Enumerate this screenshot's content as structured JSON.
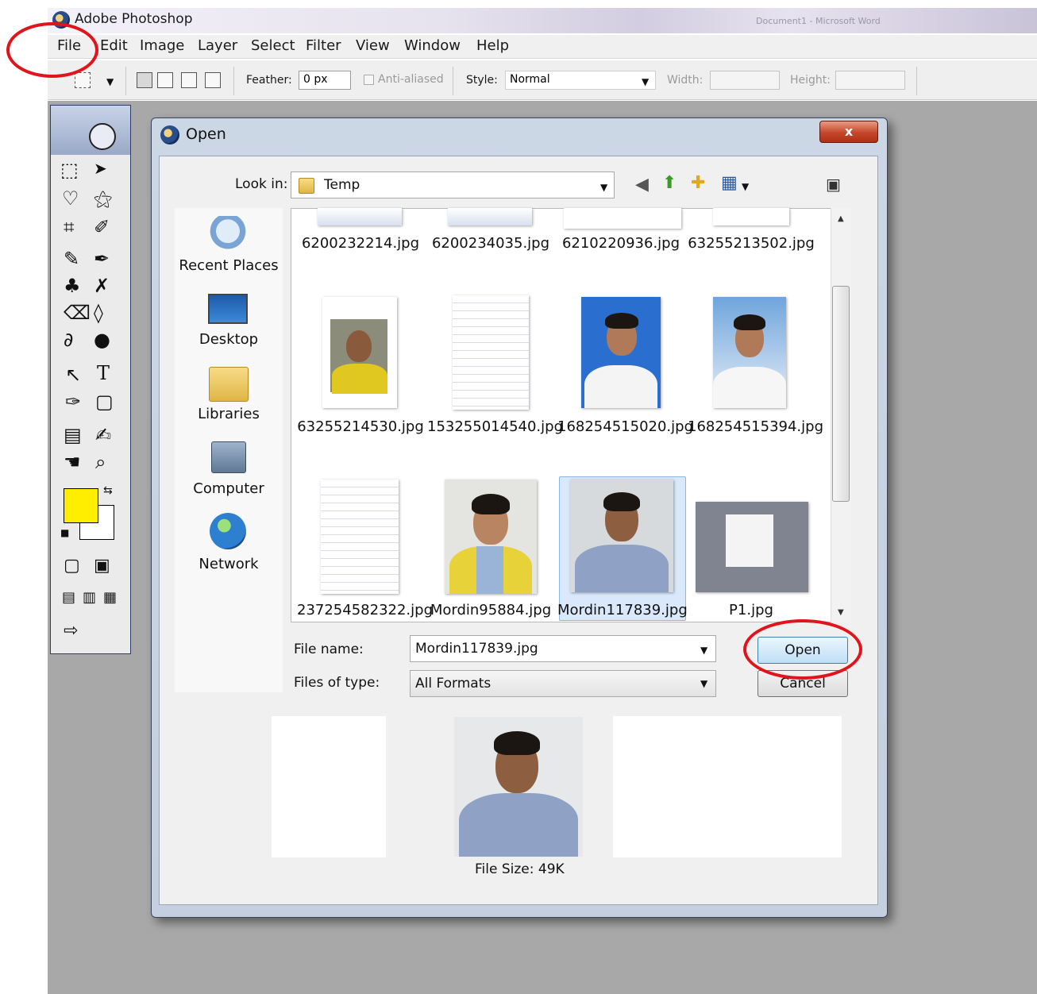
{
  "app": {
    "title": "Adobe Photoshop",
    "background_window_title": "Document1 - Microsoft Word"
  },
  "menu": [
    "File",
    "Edit",
    "Image",
    "Layer",
    "Select",
    "Filter",
    "View",
    "Window",
    "Help"
  ],
  "options": {
    "feather_label": "Feather:",
    "feather_value": "0 px",
    "anti_aliased_label": "Anti-aliased",
    "style_label": "Style:",
    "style_value": "Normal",
    "width_label": "Width:",
    "height_label": "Height:"
  },
  "tools": {
    "foreground_color": "#ffee00",
    "background_color": "#ffffff"
  },
  "dialog": {
    "title": "Open",
    "close_label": "x",
    "look_in_label": "Look in:",
    "look_in_value": "Temp",
    "places": [
      "Recent Places",
      "Desktop",
      "Libraries",
      "Computer",
      "Network"
    ],
    "files": [
      "6200232214.jpg",
      "6200234035.jpg",
      "6210220936.jpg",
      "63255213502.jpg",
      "63255214530.jpg",
      "153255014540.jpg",
      "168254515020.jpg",
      "168254515394.jpg",
      "237254582322.jpg",
      "Mordin95884.jpg",
      "Mordin117839.jpg",
      "P1.jpg"
    ],
    "selected_file": "Mordin117839.jpg",
    "file_name_label": "File name:",
    "file_name_value": "Mordin117839.jpg",
    "files_of_type_label": "Files of type:",
    "files_of_type_value": "All Formats",
    "open_button": "Open",
    "cancel_button": "Cancel",
    "file_size": "File Size: 49K"
  },
  "annotations": {
    "highlight_color": "#e0141a",
    "highlighted": [
      "File menu",
      "Open button"
    ]
  }
}
